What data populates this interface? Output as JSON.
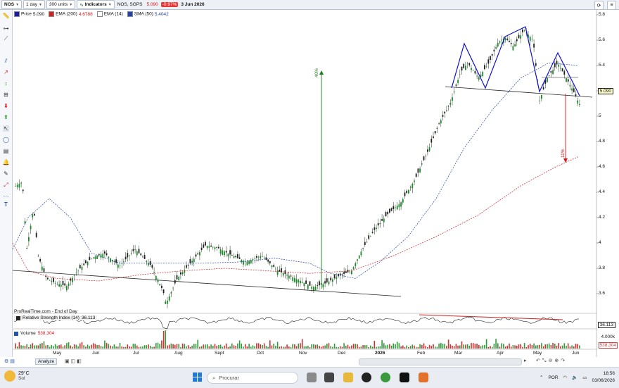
{
  "toolbar": {
    "symbol": "NOS",
    "interval": "1 day",
    "units": "300 units",
    "indicators_label": "Indicators",
    "instrument_name": "NOS, SGPS",
    "last_price": "5.090",
    "change_pct": "-0.97%",
    "date": "3 Jun 2026"
  },
  "legend": {
    "price_label": "Price",
    "price_value": "5.090",
    "ema200_label": "EMA (200)",
    "ema200_value": "4.6788",
    "ema14_label": "EMA (14)",
    "sma50_label": "SMA (50)",
    "sma50_value": "5.4042"
  },
  "source_label": "ProRealTime.com - End of Day",
  "rsi": {
    "label": "Relative Strength Index (14)",
    "value": "36.113",
    "tag": "36.113"
  },
  "volume": {
    "label": "Volume",
    "value": "538,304",
    "axis_tick": "4.000k",
    "tag": "538,304"
  },
  "price_tag": "5.090",
  "annotations": {
    "rise": "40%",
    "drop": "11%"
  },
  "analyze_label": "Analyze",
  "y_axis": {
    "ticks": [
      "5.8",
      "5.6",
      "5.4",
      "5.2",
      "5",
      "4.8",
      "4.6",
      "4.4",
      "4.2",
      "4",
      "3.8",
      "3.6"
    ]
  },
  "x_axis": {
    "labels": [
      "May",
      "Jun",
      "Jul",
      "Aug",
      "Sept",
      "Oct",
      "Nov",
      "Dec",
      "2026",
      "Feb",
      "Mar",
      "Apr",
      "May",
      "Jun"
    ]
  },
  "taskbar": {
    "temperature": "29°C",
    "weather_text": "Sol",
    "search_placeholder": "Procurar",
    "language": "POR",
    "time": "18:56",
    "date": "03/06/2026"
  },
  "colors": {
    "price_line": "#1a1aaa",
    "ema200": "#cc2222",
    "sma50": "#2244aa",
    "pattern": "#1010cc",
    "rise_arrow": "#1a7a1a",
    "drop_arrow": "#d11111"
  },
  "chart_data": {
    "type": "candlestick",
    "title": "NOS, SGPS",
    "y_range": [
      3.5,
      5.85
    ],
    "x_labels": [
      "May",
      "Jun",
      "Jul",
      "Aug",
      "Sept",
      "Oct",
      "Nov",
      "Dec",
      "2026",
      "Feb",
      "Mar",
      "Apr",
      "May",
      "Jun"
    ],
    "approx_close_path": [
      {
        "x": "Apr",
        "y": 4.45
      },
      {
        "x": "May",
        "y": 3.72
      },
      {
        "x": "Jun",
        "y": 3.85
      },
      {
        "x": "Jul",
        "y": 3.9
      },
      {
        "x": "Aug",
        "y": 3.6
      },
      {
        "x": "Sept",
        "y": 3.95
      },
      {
        "x": "Oct",
        "y": 3.85
      },
      {
        "x": "Nov",
        "y": 3.65
      },
      {
        "x": "Dec",
        "y": 3.78
      },
      {
        "x": "2026",
        "y": 4.05
      },
      {
        "x": "Feb",
        "y": 4.75
      },
      {
        "x": "Mar",
        "y": 5.3
      },
      {
        "x": "Apr",
        "y": 5.65
      },
      {
        "x": "May",
        "y": 5.2
      },
      {
        "x": "Jun",
        "y": 5.09
      }
    ],
    "series": [
      {
        "name": "EMA (200)",
        "value": 4.6788
      },
      {
        "name": "SMA (50)",
        "value": 5.4042
      }
    ],
    "grid": false
  }
}
